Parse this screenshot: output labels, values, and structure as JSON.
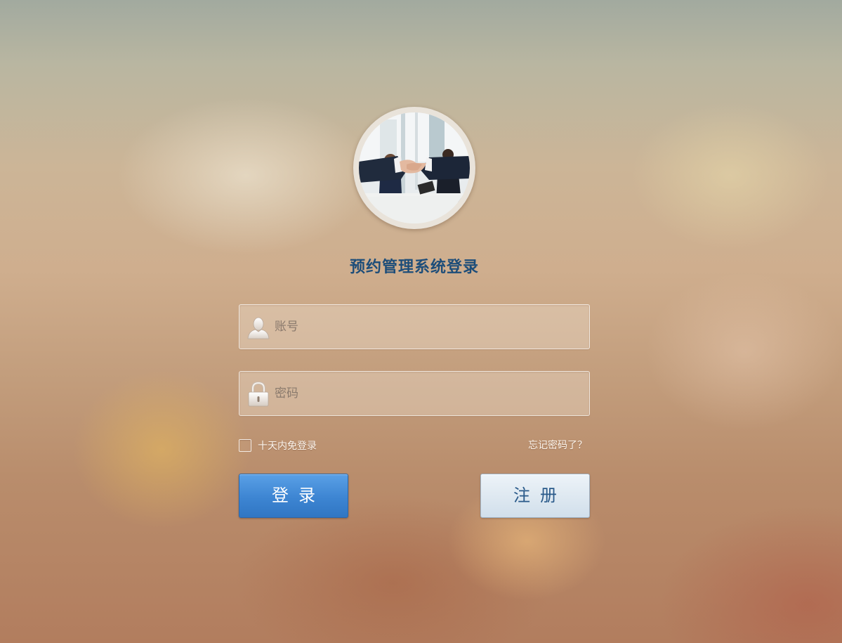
{
  "page": {
    "title": "预约管理系统登录"
  },
  "form": {
    "username_placeholder": "账号",
    "password_placeholder": "密码",
    "username_value": "",
    "password_value": "",
    "remember_label": "十天内免登录",
    "remember_checked": false,
    "forgot_label": "忘记密码了？"
  },
  "buttons": {
    "login_label": "登录",
    "register_label": "注册"
  },
  "icons": {
    "avatar": "handshake-photo",
    "username": "user-icon",
    "password": "lock-icon"
  },
  "colors": {
    "title": "#1d4d79",
    "login_button": "#3d85d2",
    "register_button": "#dce7f0",
    "register_text": "#2a5a8a"
  }
}
